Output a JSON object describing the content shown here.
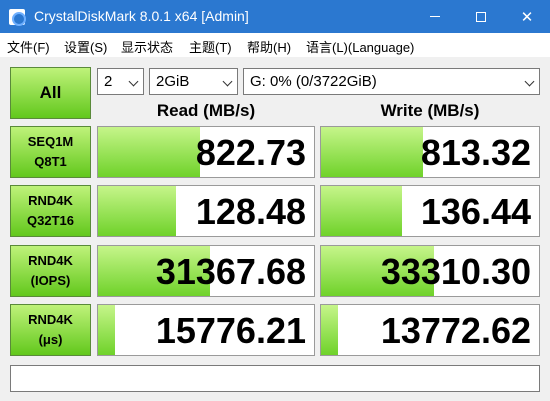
{
  "window": {
    "title": "CrystalDiskMark 8.0.1 x64 [Admin]",
    "minimize_glyph": "—",
    "maximize_glyph": "□",
    "close_glyph": "✕"
  },
  "menu": [
    {
      "label": "文件(F)"
    },
    {
      "label": "设置(S)"
    },
    {
      "label": "显示状态"
    },
    {
      "label": "主题(T)"
    },
    {
      "label": "帮助(H)"
    },
    {
      "label": "语言(L)(Language)"
    }
  ],
  "controls": {
    "all_label": "All",
    "test_count": "2",
    "test_size": "2GiB",
    "drive": "G: 0% (0/3722GiB)"
  },
  "headers": {
    "read": "Read (MB/s)",
    "write": "Write (MB/s)"
  },
  "rows": [
    {
      "line1": "SEQ1M",
      "line2": "Q8T1",
      "read": "822.73",
      "write": "813.32",
      "read_fill": 0.47,
      "write_fill": 0.47
    },
    {
      "line1": "RND4K",
      "line2": "Q32T16",
      "read": "128.48",
      "write": "136.44",
      "read_fill": 0.36,
      "write_fill": 0.37
    },
    {
      "line1": "RND4K",
      "line2": "(IOPS)",
      "read": "31367.68",
      "write": "33310.30",
      "read_fill": 0.52,
      "write_fill": 0.52
    },
    {
      "line1": "RND4K",
      "line2": "(μs)",
      "read": "15776.21",
      "write": "13772.62",
      "read_fill": 0.08,
      "write_fill": 0.08
    }
  ],
  "comment": "",
  "colors": {
    "title_bar": "#2b78d0",
    "bar_green": "#6fd22a",
    "button_green": "#62c81c"
  }
}
